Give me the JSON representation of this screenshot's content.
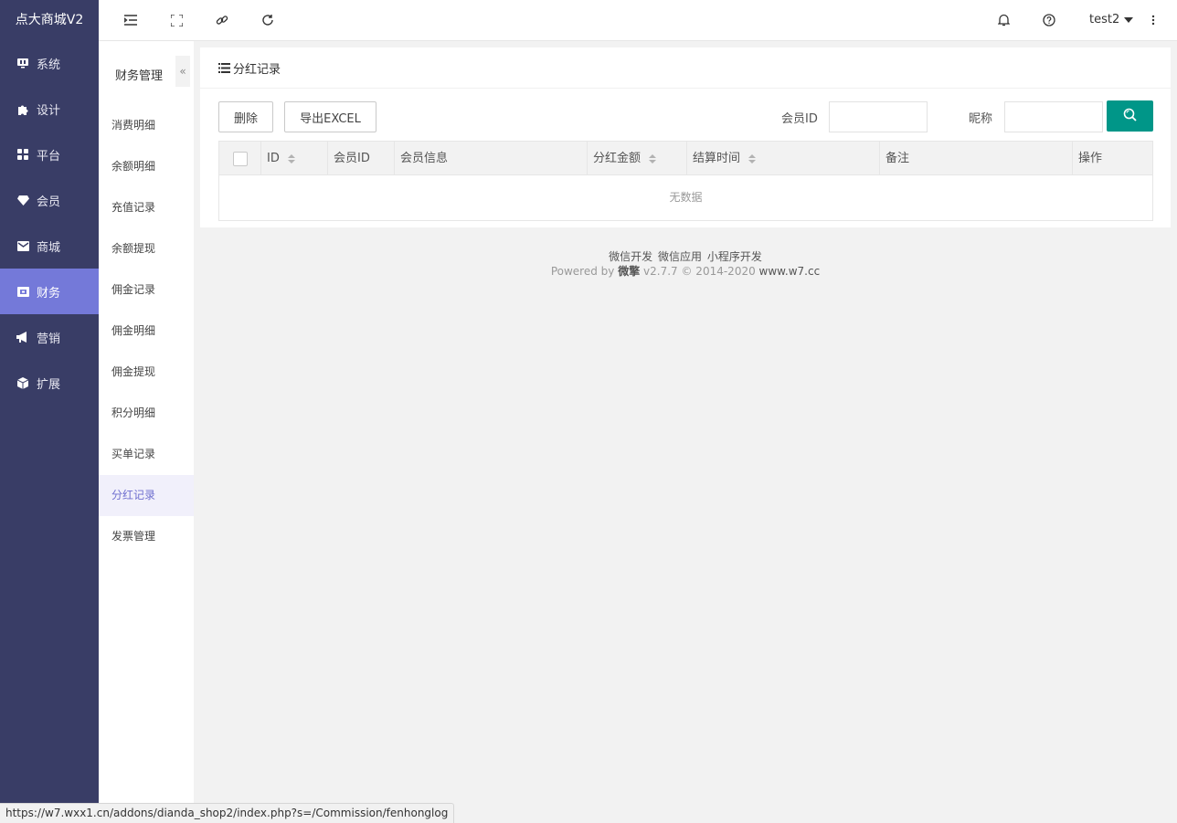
{
  "app": {
    "title": "点大商城V2"
  },
  "sidebar": {
    "items": [
      {
        "label": "系统",
        "icon": "monitor-icon"
      },
      {
        "label": "设计",
        "icon": "puzzle-icon"
      },
      {
        "label": "平台",
        "icon": "grid-icon"
      },
      {
        "label": "会员",
        "icon": "diamond-icon"
      },
      {
        "label": "商城",
        "icon": "mail-icon"
      },
      {
        "label": "财务",
        "icon": "wallet-icon",
        "active": true
      },
      {
        "label": "营销",
        "icon": "megaphone-icon"
      },
      {
        "label": "扩展",
        "icon": "cube-icon"
      }
    ]
  },
  "topbar": {
    "user": "test2",
    "icons": [
      "menu-fold-icon",
      "fullscreen-icon",
      "link-icon",
      "refresh-icon",
      "bell-icon",
      "help-icon",
      "more-icon"
    ]
  },
  "subnav": {
    "title": "财务管理",
    "collapse": "«",
    "items": [
      "消费明细",
      "余额明细",
      "充值记录",
      "余额提现",
      "佣金记录",
      "佣金明细",
      "佣金提现",
      "积分明细",
      "买单记录",
      "分红记录",
      "发票管理"
    ],
    "active": "分红记录"
  },
  "main": {
    "title": "分红记录",
    "toolbar": {
      "delete": "删除",
      "export": "导出EXCEL"
    },
    "filters": {
      "member_id_label": "会员ID",
      "member_id_value": "",
      "nickname_label": "昵称",
      "nickname_value": ""
    },
    "table": {
      "columns": [
        "ID",
        "会员ID",
        "会员信息",
        "分红金额",
        "结算时间",
        "备注",
        "操作"
      ],
      "empty": "无数据"
    }
  },
  "footer": {
    "links": [
      "微信开发",
      "微信应用",
      "小程序开发"
    ],
    "powered_by": "Powered by",
    "brand": "微擎",
    "version": "v2.7.7 © 2014-2020",
    "site": "www.w7.cc"
  },
  "statusbar": {
    "url": "https://w7.wxx1.cn/addons/dianda_shop2/index.php?s=/Commission/fenhonglog"
  },
  "colors": {
    "sidebar_bg": "#393d66",
    "sidebar_active": "#7479d9",
    "search_btn": "#009688",
    "subnav_active_text": "#6f6fcf"
  }
}
